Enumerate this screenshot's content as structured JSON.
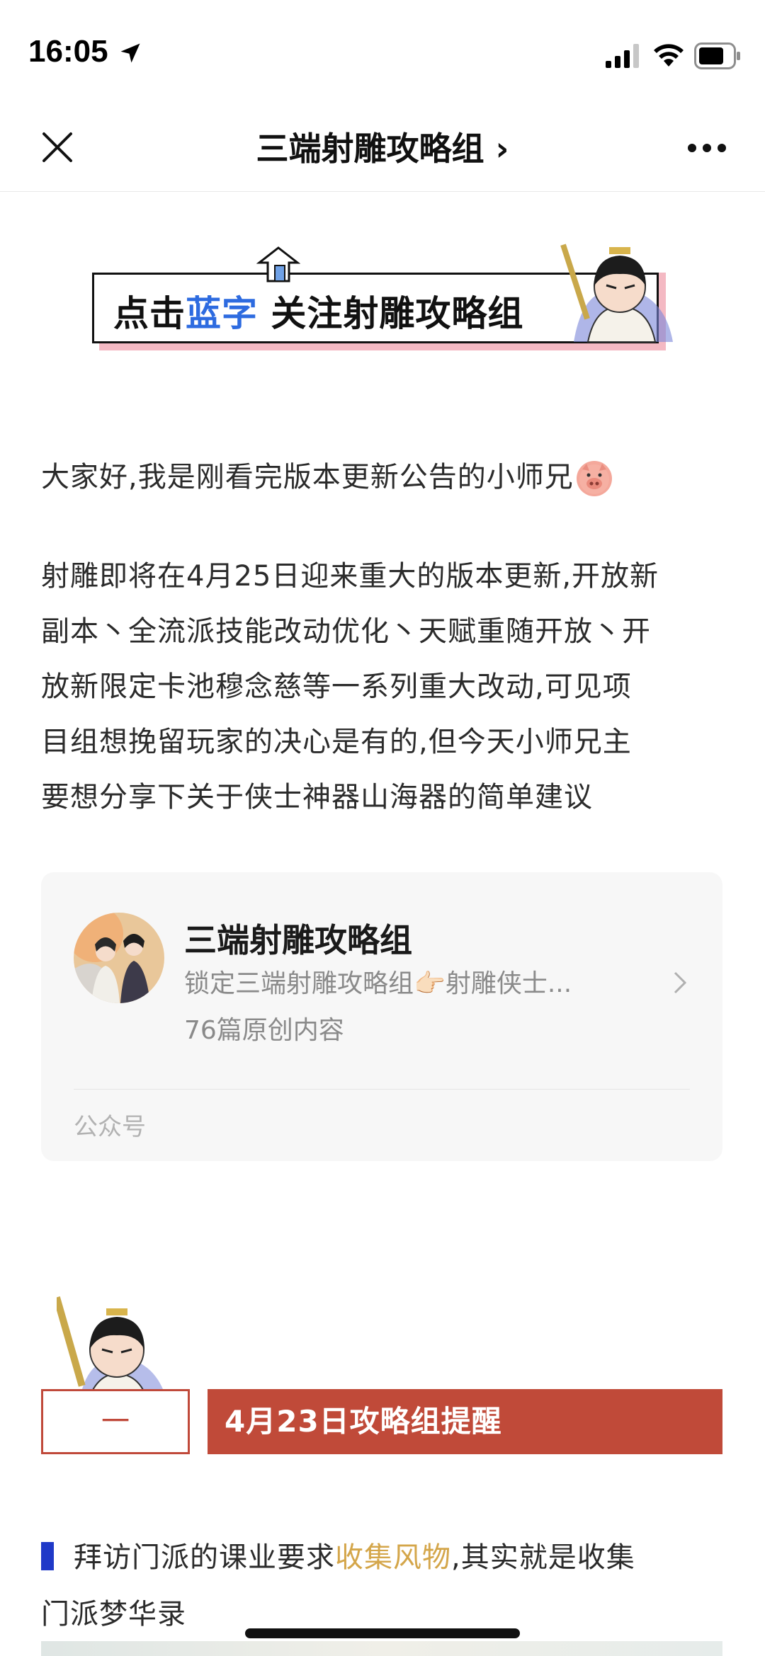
{
  "status_bar": {
    "time": "16:05"
  },
  "nav": {
    "title": "三端射雕攻略组 ›"
  },
  "banner": {
    "part1": "点击",
    "part2": "蓝字",
    "part3": " 关注射雕攻略组"
  },
  "intro": {
    "text": "大家好,我是刚看完版本更新公告的小师兄"
  },
  "body": {
    "lines": [
      "射雕即将在4月25日迎来重大的版本更新,开放新",
      "副本丶全流派技能改动优化丶天赋重随开放丶开",
      "放新限定卡池穆念慈等一系列重大改动,可见项",
      "目组想挽留玩家的决心是有的,但今天小师兄主",
      "要想分享下关于侠士神器山海器的简单建议"
    ]
  },
  "account_card": {
    "name": "三端射雕攻略组",
    "desc": "锁定三端射雕攻略组👉🏻射雕侠士...",
    "count": "76篇原创内容",
    "type": "公众号"
  },
  "section": {
    "number": "一",
    "title": "4月23日攻略组提醒"
  },
  "tip": {
    "prefix": "拜访门派的课业要求",
    "highlight": "收集风物",
    "suffix": ",其实就是收集",
    "line2": "门派梦华录"
  },
  "colors": {
    "accent_red": "#c04a39",
    "link_blue": "#2d6be0",
    "highlight_gold": "#d4a64a"
  }
}
